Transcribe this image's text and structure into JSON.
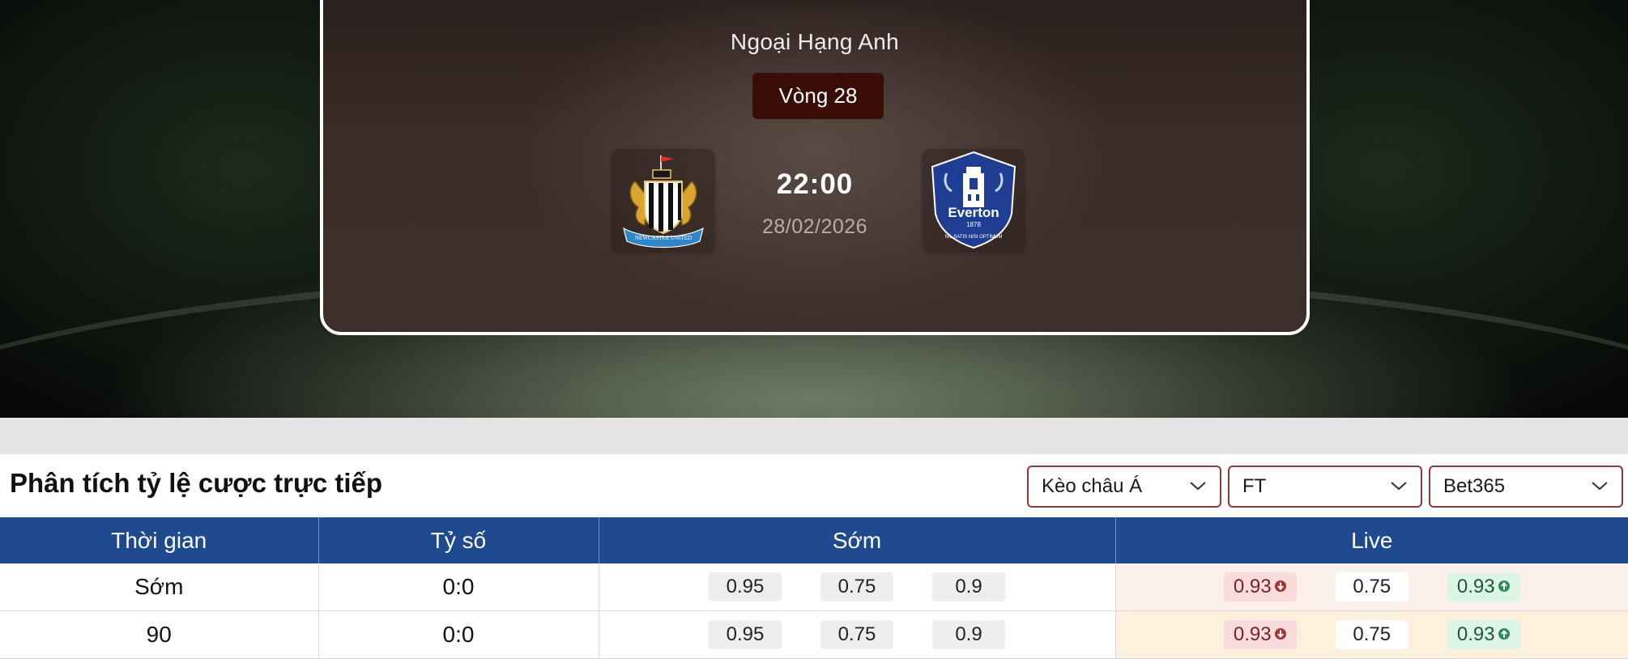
{
  "match": {
    "league": "Ngoại Hạng Anh",
    "round": "Vòng 28",
    "time": "22:00",
    "date": "28/02/2026",
    "home_team_logo": "newcastle-united-crest",
    "away_team_logo": "everton-crest",
    "away_logo_text": "Everton",
    "away_logo_year": "1878",
    "away_logo_motto": "NIL SATIS NISI OPTIMUM",
    "home_logo_text": "NEWCASTLE UNITED"
  },
  "odds_section": {
    "title": "Phân tích tỷ lệ cược trực tiếp",
    "market_select": "Kèo châu Á",
    "period_select": "FT",
    "bookmaker_select": "Bet365",
    "columns": [
      "Thời gian",
      "Tỷ số",
      "Sớm",
      "Live"
    ],
    "rows": [
      {
        "time": "Sớm",
        "score": "0:0",
        "early": [
          "0.95",
          "0.75",
          "0.9"
        ],
        "live": [
          "0.93",
          "0.75",
          "0.93"
        ],
        "live_trend": [
          "down",
          "none",
          "up"
        ]
      },
      {
        "time": "90",
        "score": "0:0",
        "early": [
          "0.95",
          "0.75",
          "0.9"
        ],
        "live": [
          "0.93",
          "0.75",
          "0.93"
        ],
        "live_trend": [
          "down",
          "none",
          "up"
        ]
      }
    ]
  },
  "colors": {
    "header_blue": "#1f4a8f",
    "round_badge": "#3a0c06",
    "dropdown_border": "#8b3b3b",
    "trend_down": "#c0392b",
    "trend_up": "#2e8b57"
  }
}
